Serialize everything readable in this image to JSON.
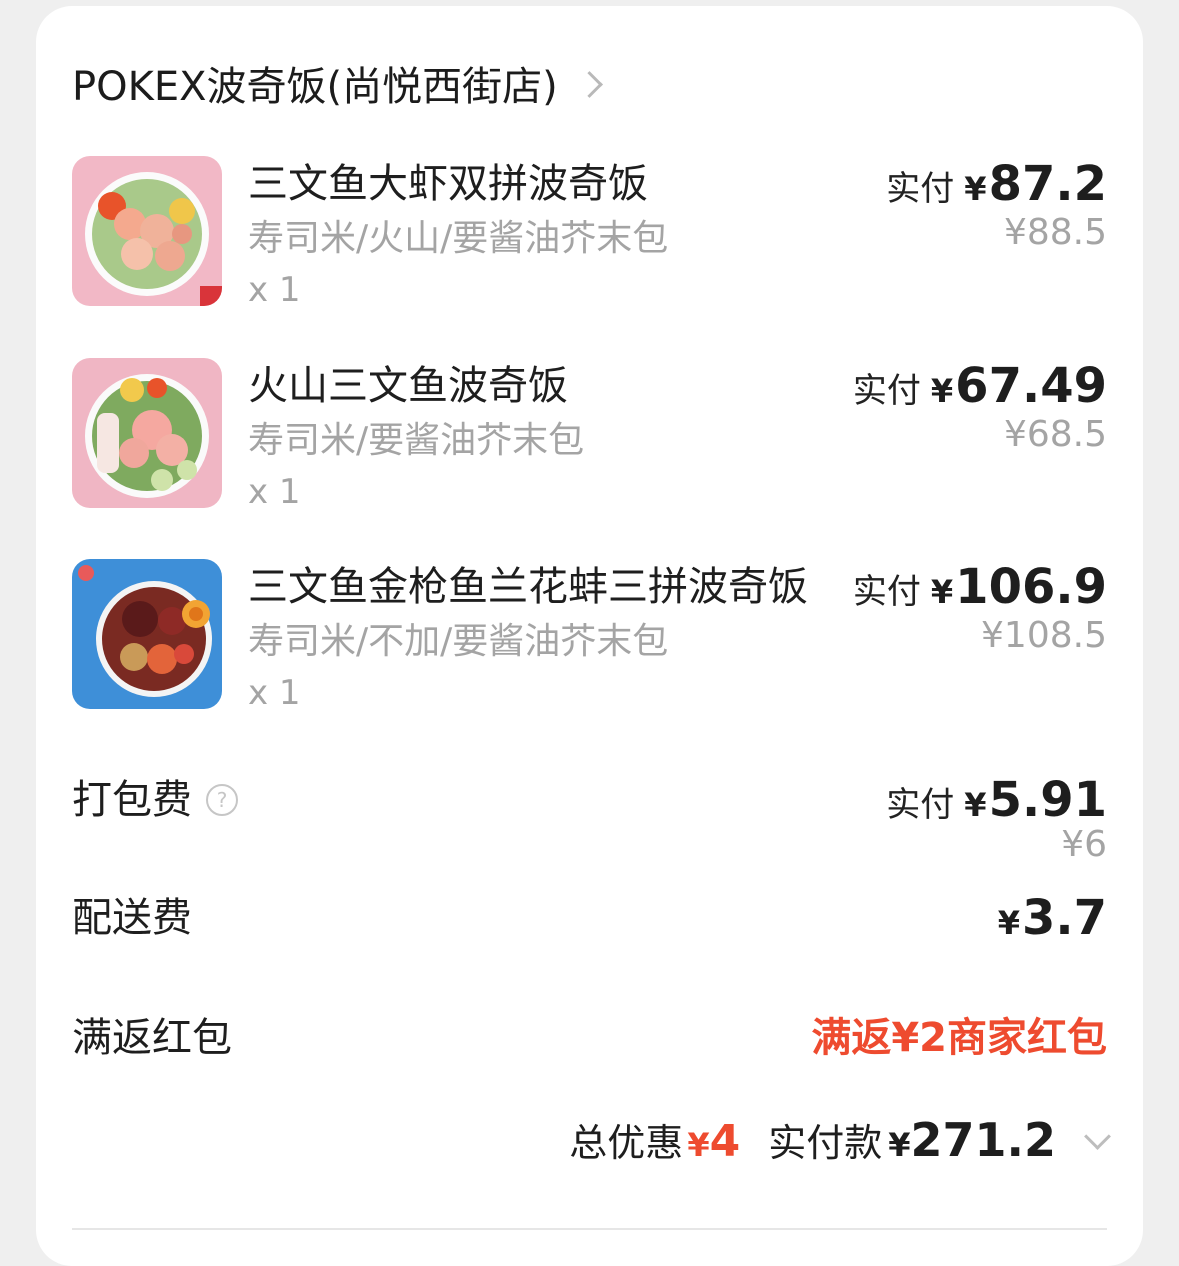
{
  "store": {
    "name": "POKEX波奇饭(尚悦西街店)",
    "chevron_icon": "chevron-right-icon"
  },
  "items": [
    {
      "name": "三文鱼大虾双拼波奇饭",
      "spec": "寿司米/火山/要酱油芥末包",
      "qty": "x 1",
      "pay_label": "实付",
      "currency": "¥",
      "pay_amount": "87.2",
      "original": "¥88.5"
    },
    {
      "name": "火山三文鱼波奇饭",
      "spec": "寿司米/要酱油芥末包",
      "qty": "x 1",
      "pay_label": "实付",
      "currency": "¥",
      "pay_amount": "67.49",
      "original": "¥68.5"
    },
    {
      "name": "三文鱼金枪鱼兰花蚌三拼波奇饭",
      "spec": "寿司米/不加/要酱油芥末包",
      "qty": "x 1",
      "pay_label": "实付",
      "currency": "¥",
      "pay_amount": "106.9",
      "original": "¥108.5"
    }
  ],
  "packing_fee": {
    "label": "打包费",
    "help_icon": "question-circle-icon",
    "help_glyph": "?",
    "pay_label": "实付",
    "currency": "¥",
    "pay_amount": "5.91",
    "original": "¥6"
  },
  "delivery_fee": {
    "label": "配送费",
    "currency": "¥",
    "amount": "3.7"
  },
  "red_packet": {
    "label": "满返红包",
    "value": "满返¥2商家红包"
  },
  "summary": {
    "discount_label": "总优惠",
    "discount_currency": "¥",
    "discount_amount": "4",
    "paid_label": "实付款",
    "paid_currency": "¥",
    "paid_amount": "271.2",
    "expand_icon": "chevron-down-icon"
  },
  "colors": {
    "accent_red": "#ee4b2f",
    "muted": "#a4a4a4"
  }
}
